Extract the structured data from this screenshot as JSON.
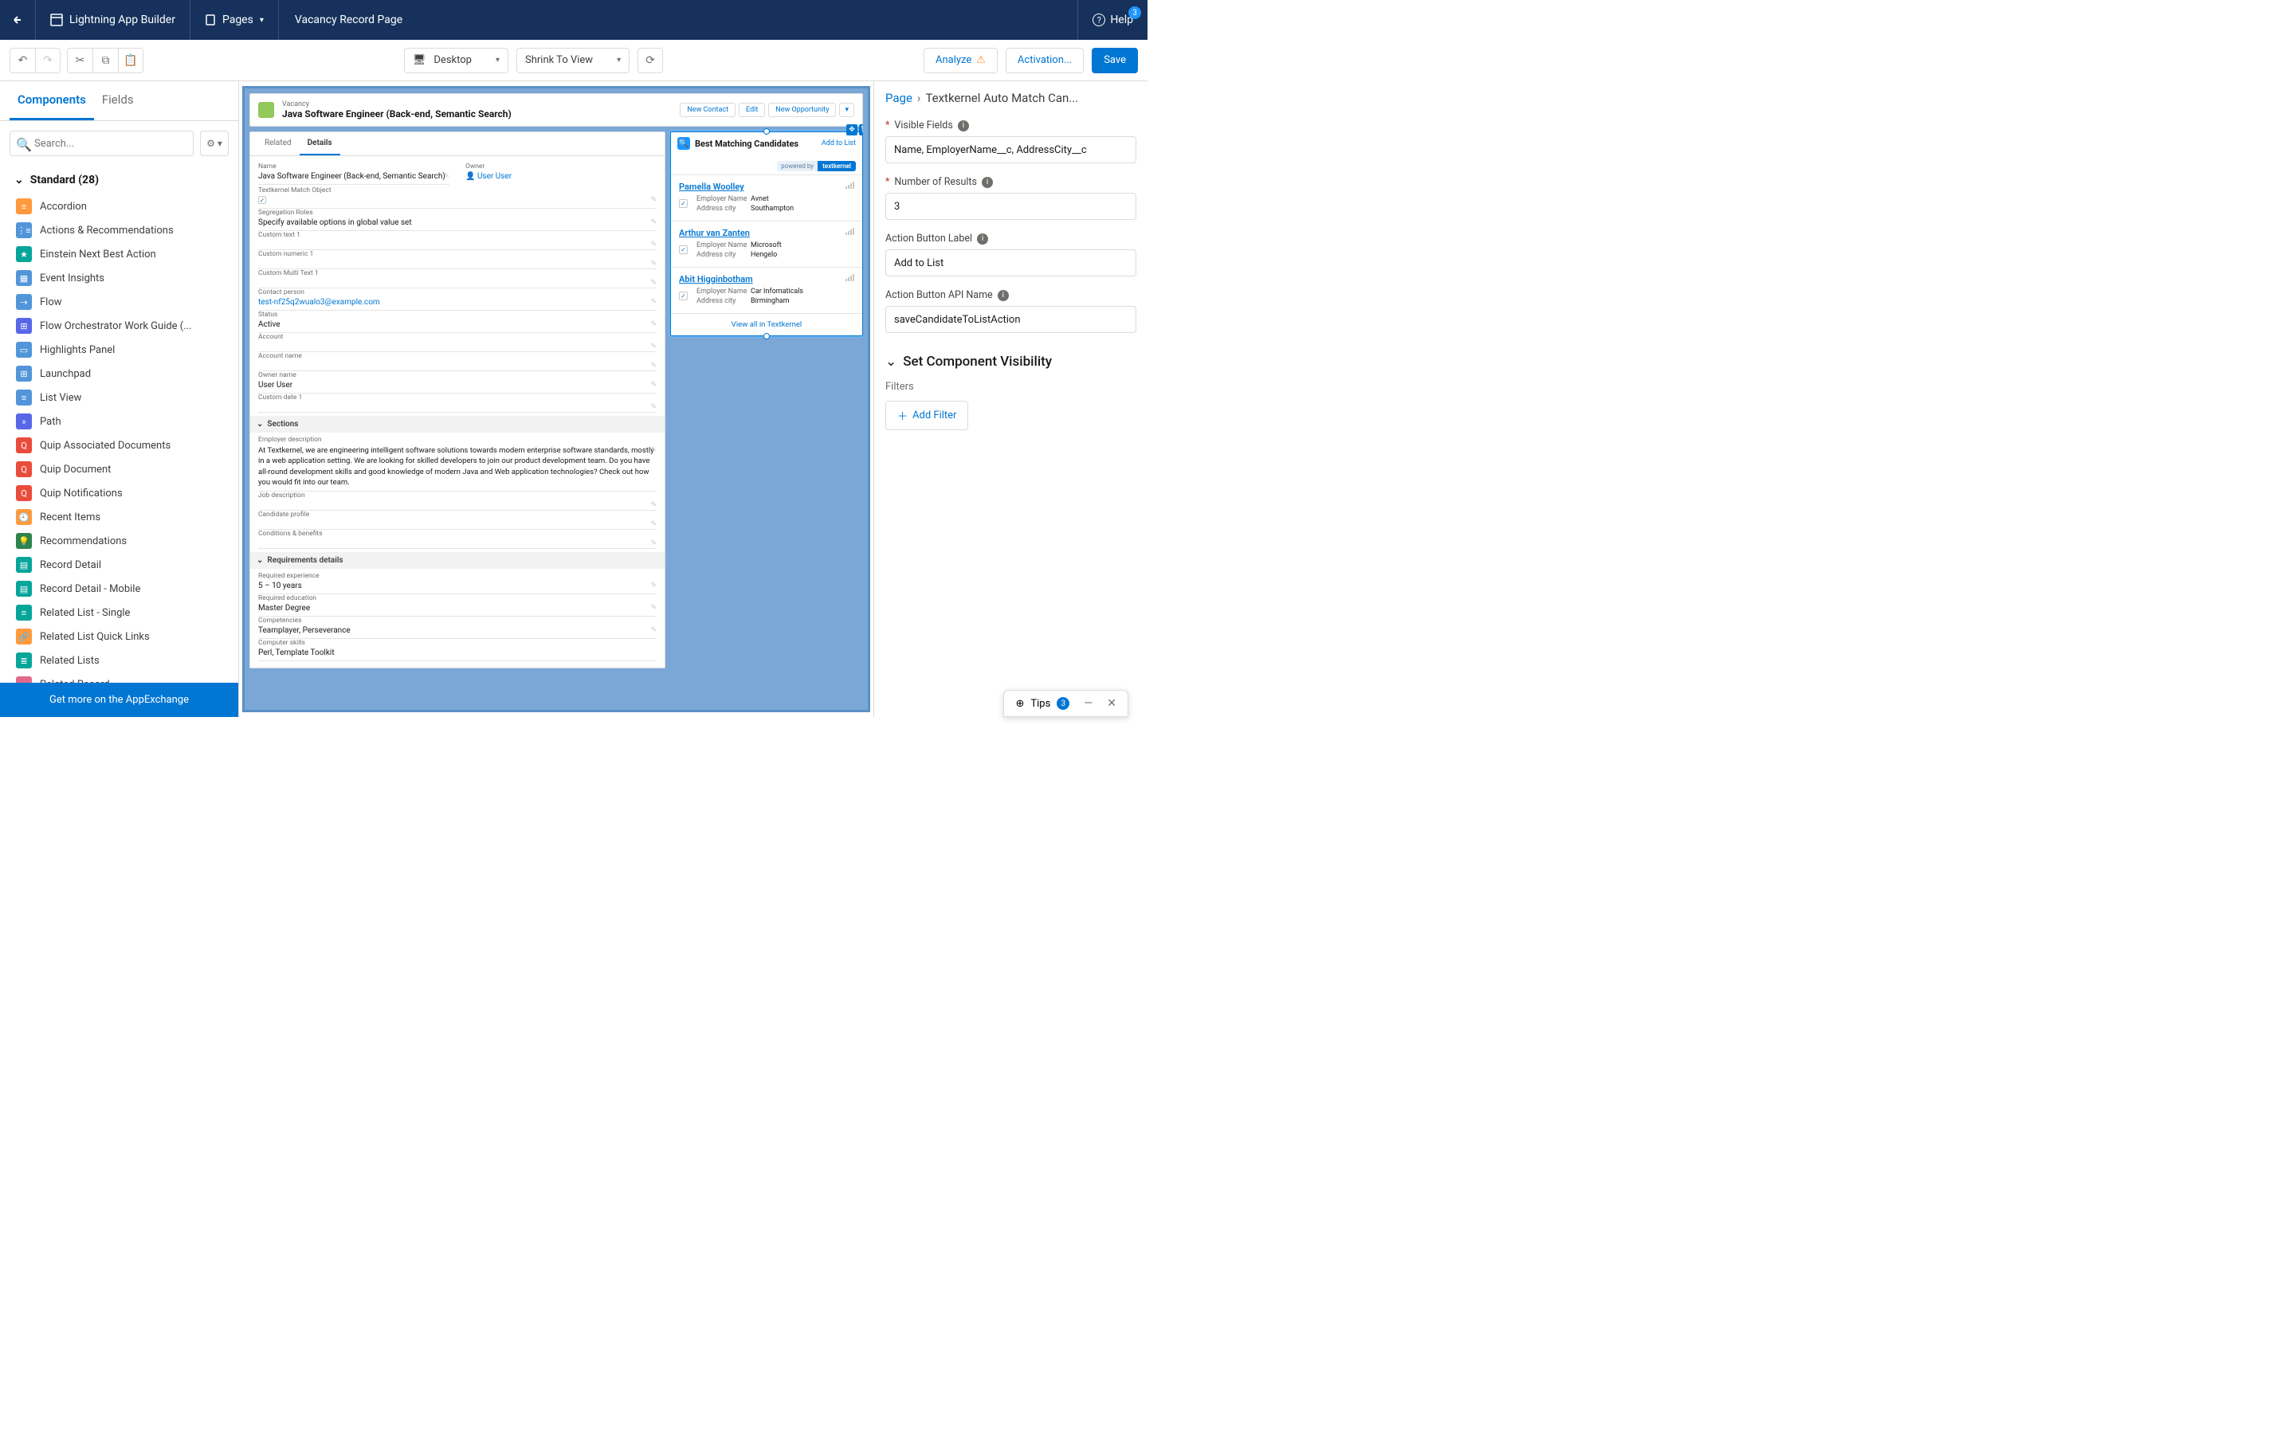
{
  "topnav": {
    "appBuilder": "Lightning App Builder",
    "pages": "Pages",
    "pageTitle": "Vacancy Record Page",
    "help": "Help",
    "helpBadge": "3"
  },
  "toolbar": {
    "deviceLabel": "Desktop",
    "zoomLabel": "Shrink To View",
    "analyze": "Analyze",
    "activation": "Activation...",
    "save": "Save"
  },
  "leftpane": {
    "tabComponents": "Components",
    "tabFields": "Fields",
    "searchPlaceholder": "Search...",
    "sectionStandard": "Standard (28)",
    "components": [
      {
        "label": "Accordion",
        "cls": "ic-orange",
        "g": "≡"
      },
      {
        "label": "Actions & Recommendations",
        "cls": "ic-blue",
        "g": "⋮≡"
      },
      {
        "label": "Einstein Next Best Action",
        "cls": "ic-teal",
        "g": "★"
      },
      {
        "label": "Event Insights",
        "cls": "ic-blue",
        "g": "▦"
      },
      {
        "label": "Flow",
        "cls": "ic-blue",
        "g": "⇢"
      },
      {
        "label": "Flow Orchestrator Work Guide (...",
        "cls": "ic-indigo",
        "g": "⊞"
      },
      {
        "label": "Highlights Panel",
        "cls": "ic-blue",
        "g": "▭"
      },
      {
        "label": "Launchpad",
        "cls": "ic-blue",
        "g": "⊞"
      },
      {
        "label": "List View",
        "cls": "ic-blue",
        "g": "≡"
      },
      {
        "label": "Path",
        "cls": "ic-indigo",
        "g": "»"
      },
      {
        "label": "Quip Associated Documents",
        "cls": "ic-red",
        "g": "Q"
      },
      {
        "label": "Quip Document",
        "cls": "ic-red",
        "g": "Q"
      },
      {
        "label": "Quip Notifications",
        "cls": "ic-red",
        "g": "Q"
      },
      {
        "label": "Recent Items",
        "cls": "ic-orange",
        "g": "🕘"
      },
      {
        "label": "Recommendations",
        "cls": "ic-green",
        "g": "💡"
      },
      {
        "label": "Record Detail",
        "cls": "ic-teal",
        "g": "▤"
      },
      {
        "label": "Record Detail - Mobile",
        "cls": "ic-teal",
        "g": "▤"
      },
      {
        "label": "Related List - Single",
        "cls": "ic-teal",
        "g": "≡"
      },
      {
        "label": "Related List Quick Links",
        "cls": "ic-orange",
        "g": "🔗"
      },
      {
        "label": "Related Lists",
        "cls": "ic-teal",
        "g": "≣"
      },
      {
        "label": "Related Record",
        "cls": "ic-pink",
        "g": "▭"
      }
    ],
    "appExchange": "Get more on the AppExchange"
  },
  "canvas": {
    "recordType": "Vacancy",
    "recordTitle": "Java Software Engineer (Back-end, Semantic Search)",
    "actions": [
      "New Contact",
      "Edit",
      "New Opportunity"
    ],
    "tabs": {
      "related": "Related",
      "details": "Details"
    },
    "fields": {
      "nameLabel": "Name",
      "name": "Java Software Engineer (Back-end, Semantic Search)",
      "ownerLabel": "Owner",
      "owner": "User User",
      "tkMatchLabel": "Textkernel Match Object",
      "segRolesLabel": "Segregation Roles",
      "segRoles": "Specify available options in global value set",
      "customText1Label": "Custom text 1",
      "customNumeric1Label": "Custom numeric 1",
      "customMultiText1Label": "Custom Multi Text 1",
      "contactPersonLabel": "Contact person",
      "contactPerson": "test-nf25q2wualo3@example.com",
      "statusLabel": "Status",
      "status": "Active",
      "accountLabel": "Account",
      "accountNameLabel": "Account name",
      "ownerNameLabel": "Owner name",
      "ownerName": "User User",
      "customDate1Label": "Custom date 1"
    },
    "sectionsHeader": "Sections",
    "sections": {
      "empDescLabel": "Employer description",
      "empDesc": "At Textkernel, we are engineering intelligent software solutions towards modern enterprise software standards, mostly in a web application setting. We are looking for skilled developers to join our product development team. Do you have all-round development skills and good knowledge of modern Java and Web application technologies? Check out how you would fit into our team.",
      "jobDescLabel": "Job description",
      "candProfileLabel": "Candidate profile",
      "condBenefitsLabel": "Conditions & benefits"
    },
    "reqHeader": "Requirements details",
    "req": {
      "expLabel": "Required experience",
      "exp": "5 – 10 years",
      "eduLabel": "Required education",
      "edu": "Master Degree",
      "compLabel": "Competencies",
      "comp": "Teamplayer, Perseverance",
      "skillsLabel": "Computer skills",
      "skills": "Perl, Template Toolkit"
    },
    "match": {
      "title": "Best Matching Candidates",
      "addToList": "Add to List",
      "poweredBy": "powered by",
      "brand": "textkernel",
      "viewAll": "View all in Textkernel",
      "empNameKey": "Employer Name",
      "addrCityKey": "Address city",
      "candidates": [
        {
          "name": "Pamella Woolley",
          "employer": "Avnet",
          "city": "Southampton"
        },
        {
          "name": "Arthur van Zanten",
          "employer": "Microsoft",
          "city": "Hengelo"
        },
        {
          "name": "Abit Higginbotham",
          "employer": "Car Infomaticals",
          "city": "Birmingham"
        }
      ]
    }
  },
  "rightpane": {
    "breadcrumbPage": "Page",
    "breadcrumbCurrent": "Textkernel Auto Match Can...",
    "visibleFieldsLabel": "Visible Fields",
    "visibleFieldsValue": "Name, EmployerName__c, AddressCity__c",
    "numResultsLabel": "Number of Results",
    "numResultsValue": "3",
    "actionLabelLabel": "Action Button Label",
    "actionLabelValue": "Add to List",
    "actionApiLabel": "Action Button API Name",
    "actionApiValue": "saveCandidateToListAction",
    "visibilityHeader": "Set Component Visibility",
    "filtersLabel": "Filters",
    "addFilter": "Add Filter"
  },
  "tips": {
    "label": "Tips",
    "count": "3"
  }
}
